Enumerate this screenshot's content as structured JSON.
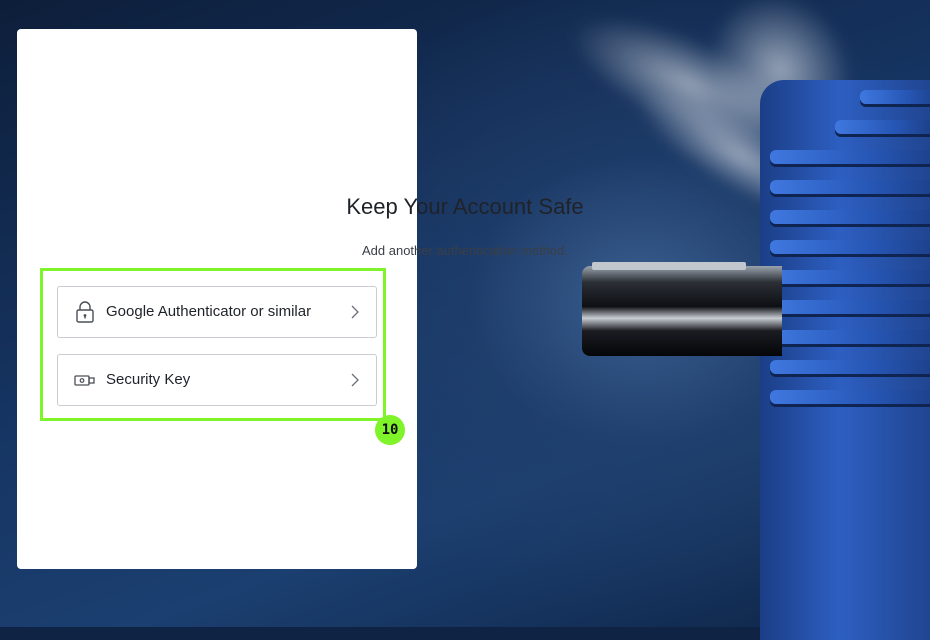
{
  "page": {
    "title": "Keep Your Account Safe",
    "subtitle": "Add another authentication method."
  },
  "options": [
    {
      "label": "Google Authenticator or similar",
      "icon": "lock-icon"
    },
    {
      "label": "Security Key",
      "icon": "usb-key-icon"
    }
  ],
  "annotation": {
    "badge": "10",
    "color": "#7ff42a"
  },
  "colors": {
    "card_bg": "#ffffff",
    "background": "#163563",
    "motor_blue": "#2d5fc2"
  }
}
